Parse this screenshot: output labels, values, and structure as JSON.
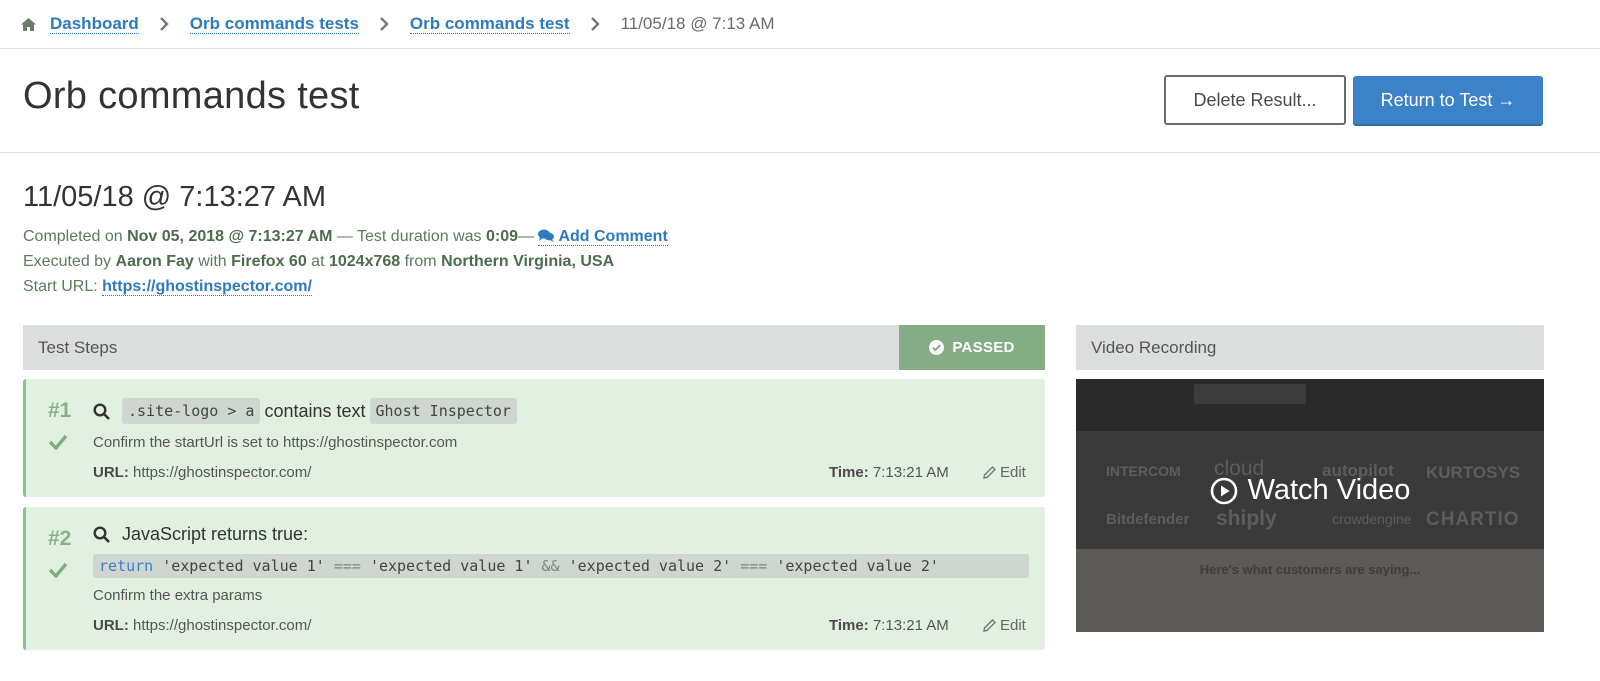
{
  "breadcrumb": {
    "home_icon": "home-icon",
    "items": [
      "Dashboard",
      "Orb commands tests",
      "Orb commands test"
    ],
    "current": "11/05/18 @ 7:13 AM"
  },
  "header": {
    "title": "Orb commands test",
    "delete_label": "Delete Result...",
    "return_label": "Return to Test →"
  },
  "result": {
    "date_title": "11/05/18 @ 7:13:27 AM",
    "completed_prefix": "Completed on",
    "completed_at": "Nov 05, 2018 @ 7:13:27 AM",
    "duration_prefix": " — Test duration was",
    "duration": "0:09",
    "duration_suffix": "—",
    "add_comment": "Add Comment",
    "executed_prefix": "Executed by",
    "user": "Aaron Fay",
    "with": "with",
    "browser": "Firefox 60",
    "at": "at",
    "resolution": "1024x768",
    "from": "from",
    "location": "Northern Virginia, USA",
    "start_url_label": "Start URL:",
    "start_url": "https://ghostinspector.com/"
  },
  "steps_panel": {
    "title": "Test Steps",
    "status": "PASSED",
    "status_color": "#85ad85"
  },
  "steps": [
    {
      "number": "#1",
      "selector": ".site-logo > a",
      "condition": "contains text",
      "value": "Ghost Inspector",
      "description": "Confirm the startUrl is set to https://ghostinspector.com",
      "url_label": "URL:",
      "url": "https://ghostinspector.com/",
      "time_label": "Time:",
      "time": "7:13:21 AM",
      "edit": "Edit"
    },
    {
      "number": "#2",
      "title": "JavaScript returns true:",
      "code": {
        "keyword": "return",
        "s1": "'expected value 1'",
        "op1": "===",
        "s2": "'expected value 1'",
        "and": "&&",
        "s3": "'expected value 2'",
        "op2": "===",
        "s4": "'expected value 2'"
      },
      "description": "Confirm the extra params",
      "url_label": "URL:",
      "url": "https://ghostinspector.com/",
      "time_label": "Time:",
      "time": "7:13:21 AM",
      "edit": "Edit"
    }
  ],
  "video": {
    "title": "Video Recording",
    "watch_label": "Watch Video",
    "thumbnail_logos": [
      "INTERCOM",
      "cloud",
      "autopilot",
      "KURTOSYS",
      "Bitdefender",
      "shiply",
      "crowdengine",
      "CHARTIO"
    ],
    "thumbnail_heading": "Here's what customers are saying..."
  }
}
